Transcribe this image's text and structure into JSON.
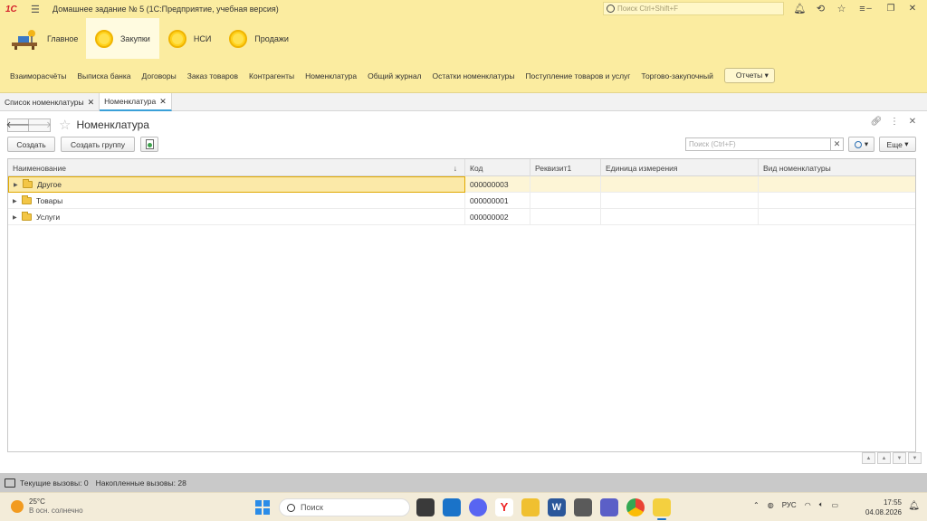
{
  "titlebar": {
    "logo": "1С",
    "title": "Домашнее задание № 5  (1С:Предприятие, учебная версия)",
    "search_placeholder": "Поиск Ctrl+Shift+F"
  },
  "sections": [
    {
      "label": "Главное"
    },
    {
      "label": "Закупки"
    },
    {
      "label": "НСИ"
    },
    {
      "label": "Продажи"
    }
  ],
  "functions": [
    "Взаиморасчёты",
    "Выписка банка",
    "Договоры",
    "Заказ товаров",
    "Контрагенты",
    "Номенклатура",
    "Общий журнал",
    "Остатки номенклатуры",
    "Поступление товаров и услуг",
    "Торгово-закупочный"
  ],
  "reports_label": "Отчеты",
  "tabs": [
    {
      "label": "Список номенклатуры"
    },
    {
      "label": "Номенклатура"
    }
  ],
  "form": {
    "title": "Номенклатура",
    "create_label": "Создать",
    "create_group_label": "Создать группу",
    "search_placeholder": "Поиск (Ctrl+F)",
    "more_label": "Еще"
  },
  "table": {
    "columns": [
      "Наименование",
      "Код",
      "Реквизит1",
      "Единица измерения",
      "Вид номенклатуры"
    ],
    "rows": [
      {
        "name": "Другое",
        "code": "000000003",
        "rekv": "",
        "unit": "",
        "kind": ""
      },
      {
        "name": "Товары",
        "code": "000000001",
        "rekv": "",
        "unit": "",
        "kind": ""
      },
      {
        "name": "Услуги",
        "code": "000000002",
        "rekv": "",
        "unit": "",
        "kind": ""
      }
    ]
  },
  "status": {
    "current_calls": "Текущие вызовы: 0",
    "accumulated_calls": "Накопленные вызовы: 28"
  },
  "taskbar": {
    "temperature": "25°C",
    "weather": "В осн. солнечно",
    "search": "Поиск",
    "language": "РУС",
    "time": "17:55",
    "date": "04.08.2026"
  },
  "colors": {
    "panel_yellow": "#fbeca0",
    "selected_row": "#fdf5d6",
    "selected_border": "#e0a800"
  }
}
